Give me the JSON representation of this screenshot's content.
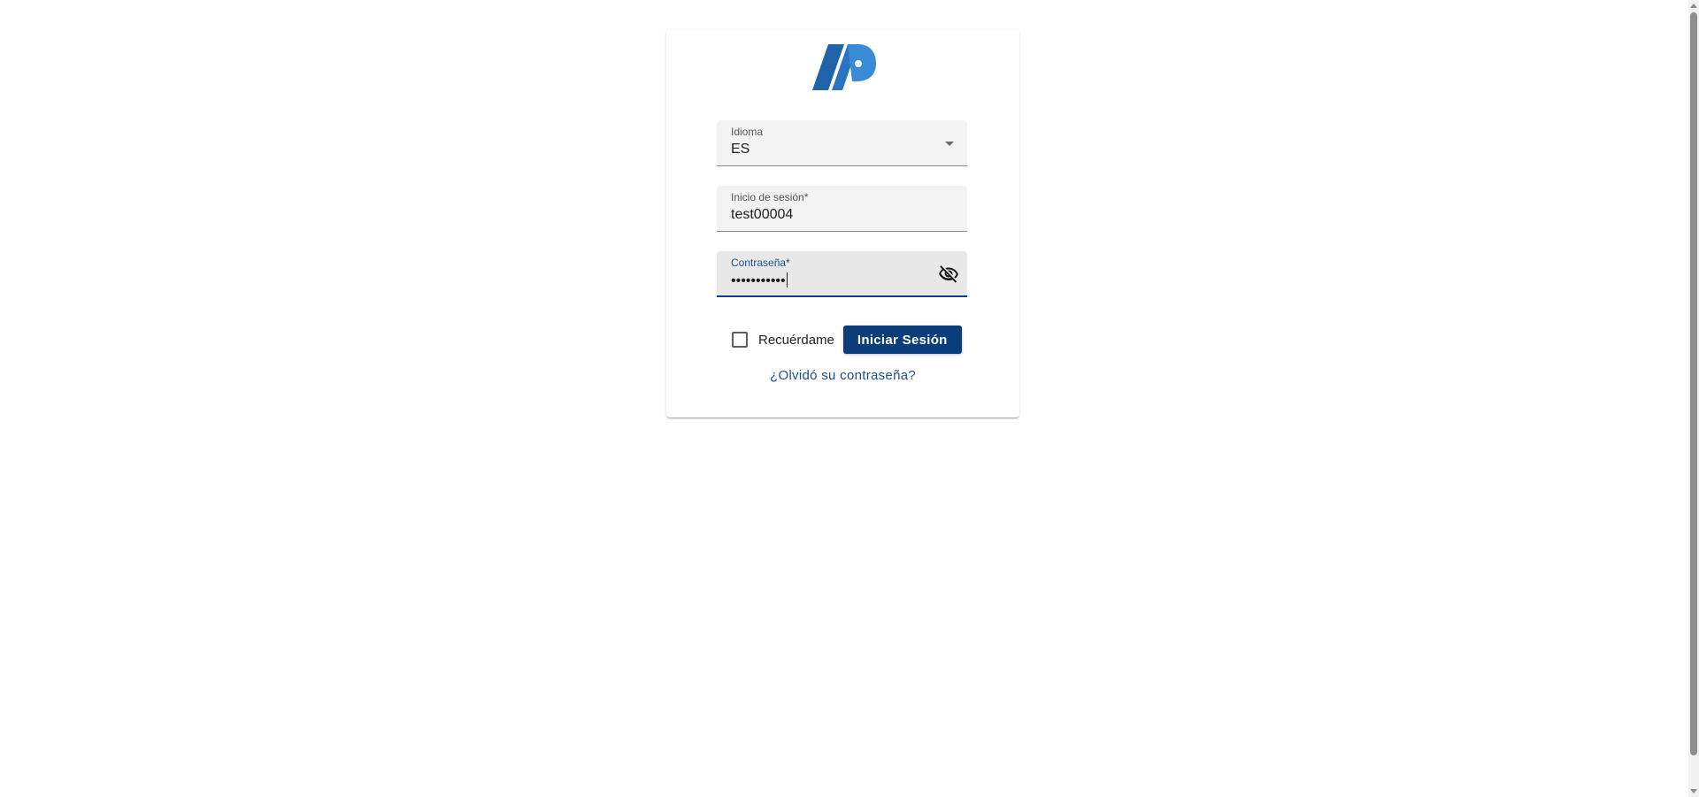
{
  "login": {
    "language": {
      "label": "Idioma",
      "value": "ES"
    },
    "username": {
      "label": "Inicio de sesión*",
      "value": "test00004"
    },
    "password": {
      "label": "Contraseña*",
      "masked_value": "•••••••••••"
    },
    "remember": {
      "label": "Recuérdame",
      "checked": false
    },
    "submit_label": "Iniciar Sesión",
    "forgot_label": "¿Olvidó su contraseña?"
  },
  "icons": {
    "password_toggle": "eye-off-icon",
    "language_dropdown": "caret-down-icon"
  },
  "colors": {
    "primary": "#0b3d7a",
    "link": "#1d4f91",
    "logo_dark": "#1f63a8",
    "logo_light": "#3b8ad6"
  }
}
